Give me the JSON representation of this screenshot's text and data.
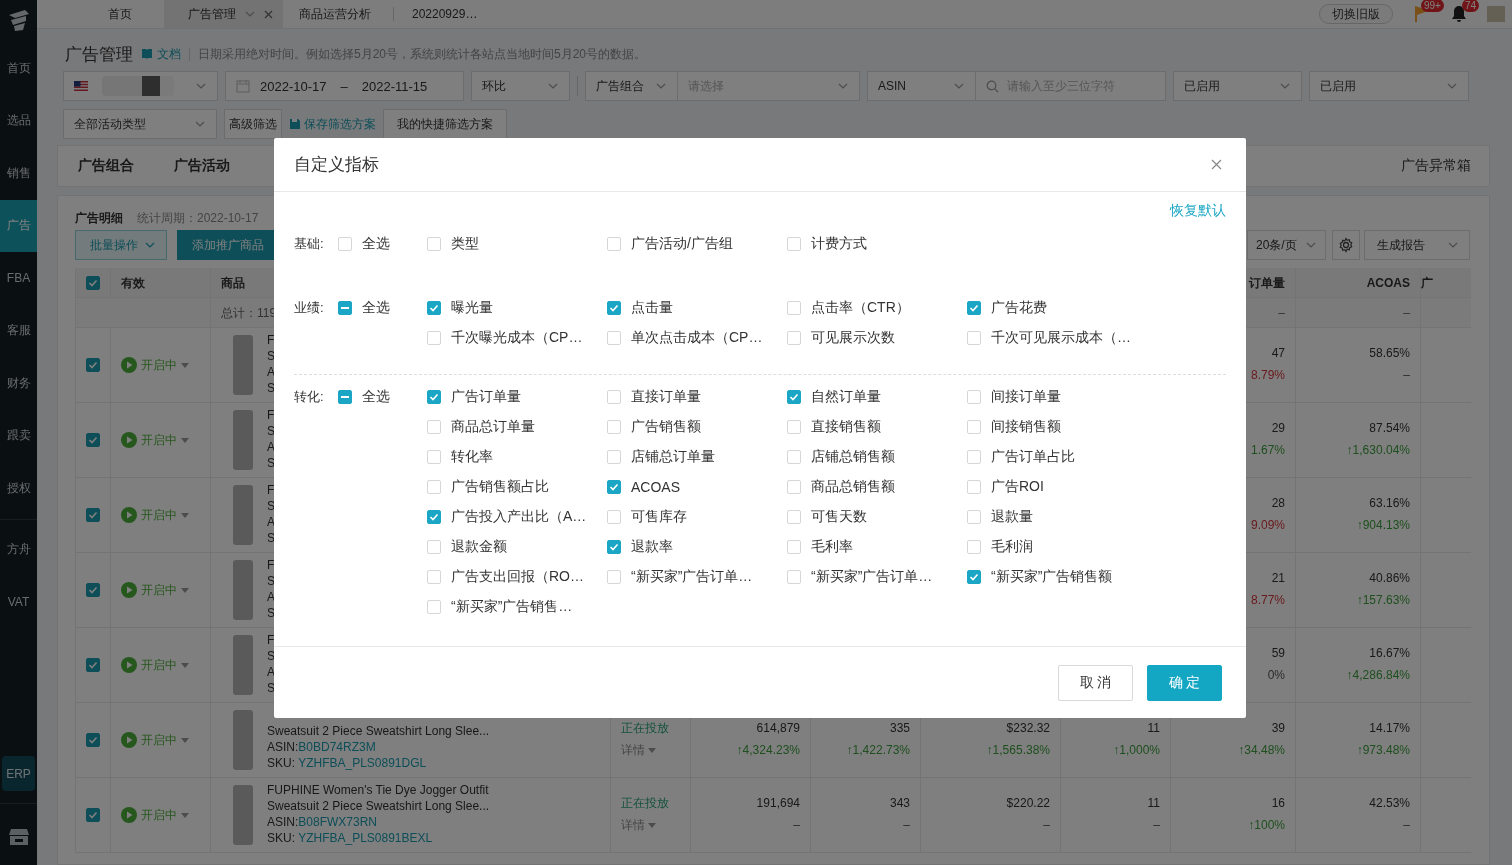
{
  "sidebar": {
    "sections": [
      {
        "items": [
          {
            "label": "首页",
            "selected": false
          },
          {
            "label": "选品",
            "selected": false
          },
          {
            "label": "销售",
            "selected": false
          },
          {
            "label": "广告",
            "selected": true
          },
          {
            "label": "FBA",
            "selected": false
          },
          {
            "label": "客服",
            "selected": false
          },
          {
            "label": "财务",
            "selected": false
          },
          {
            "label": "跟卖",
            "selected": false
          },
          {
            "label": "授权",
            "selected": false
          }
        ]
      },
      {
        "items": [
          {
            "label": "方舟",
            "selected": false
          },
          {
            "label": "VAT",
            "selected": false
          }
        ]
      }
    ],
    "erp": "ERP"
  },
  "tabs": [
    {
      "label": "首页",
      "selected": false,
      "closable": false
    },
    {
      "label": "广告管理",
      "selected": true,
      "closable": true
    },
    {
      "label": "商品运营分析",
      "selected": false,
      "closable": false
    },
    {
      "label": "20220929…",
      "selected": false,
      "closable": false
    }
  ],
  "header_right": {
    "switch_button": "切换旧版",
    "flag_badge": "99+",
    "bell_badge": "74"
  },
  "page": {
    "title": "广告管理",
    "doc_link": "文档",
    "note": "日期采用绝对时间。例如选择5月20号，系统则统计各站点当地时间5月20号的数据。"
  },
  "filters": {
    "date_start": "2022-10-17",
    "date_sep": "–",
    "date_end": "2022-11-15",
    "compare": "环比",
    "group_type": "广告组合",
    "group_placeholder": "请选择",
    "search_type": "ASIN",
    "search_placeholder": "请输入至少三位字符",
    "status_1": "已启用",
    "status_2": "已启用",
    "campaign_type": "全部活动类型",
    "advanced": "高级筛选",
    "save_scheme": "保存筛选方案",
    "my_schemes": "我的快捷筛选方案"
  },
  "view_tabs": {
    "left": [
      "广告组合",
      "广告活动"
    ],
    "right": "广告异常箱"
  },
  "table_card": {
    "title": "广告明细",
    "period": "统计周期：2022-10-17",
    "batch_button": "批量操作",
    "add_button": "添加推广商品",
    "page_size": "20条/页",
    "report_button": "生成报告"
  },
  "table": {
    "header": {
      "checked": true,
      "status": "有效",
      "product": "商品",
      "column_9": "订单量",
      "column_10": "ACOAS",
      "column_11": "广"
    },
    "summary": {
      "product": "总计：119",
      "column_9": "–",
      "column_10": "–"
    },
    "rows": [
      {
        "checked": true,
        "status": "开启中",
        "product": [
          {
            "text": "F"
          },
          {
            "text": "S"
          },
          {
            "text": "A"
          },
          {
            "text": "S"
          }
        ],
        "column_9": {
          "value": "47",
          "change": "8.79%",
          "rising": false,
          "falling": true
        },
        "column_10": {
          "value": "58.65%",
          "change": "–",
          "rising": false,
          "falling": false
        }
      },
      {
        "checked": true,
        "status": "开启中",
        "product": [
          {
            "text": "F"
          },
          {
            "text": "S"
          },
          {
            "text": "A"
          },
          {
            "text": "S"
          }
        ],
        "column_9": {
          "value": "29",
          "change": "1.67%",
          "rising": true,
          "falling": false
        },
        "column_10": {
          "value": "87.54%",
          "change": "↑1,630.04%",
          "rising": true,
          "falling": false
        }
      },
      {
        "checked": true,
        "status": "开启中",
        "product": [
          {
            "text": "F"
          },
          {
            "text": "S"
          },
          {
            "text": "A"
          },
          {
            "text": "S"
          }
        ],
        "column_9": {
          "value": "28",
          "change": "9.09%",
          "rising": false,
          "falling": true
        },
        "column_10": {
          "value": "63.16%",
          "change": "↑904.13%",
          "rising": true,
          "falling": false
        }
      },
      {
        "checked": true,
        "status": "开启中",
        "product": [
          {
            "text": "F"
          },
          {
            "text": "S"
          },
          {
            "text": "A"
          },
          {
            "text": "S"
          }
        ],
        "column_9": {
          "value": "21",
          "change": "8.77%",
          "rising": false,
          "falling": true
        },
        "column_10": {
          "value": "40.86%",
          "change": "↑157.63%",
          "rising": true,
          "falling": false
        }
      },
      {
        "checked": true,
        "status": "开启中",
        "product": [
          {
            "text": "F"
          },
          {
            "text": "S"
          },
          {
            "text": "A"
          },
          {
            "text": "S"
          }
        ],
        "column_9": {
          "value": "59",
          "change": "0%",
          "rising": false,
          "falling": false
        },
        "column_10": {
          "value": "16.67%",
          "change": "↑4,286.84%",
          "rising": true,
          "falling": false
        }
      },
      {
        "checked": true,
        "status": "开启中",
        "product": [
          {
            "text": "Sweatsuit 2 Piece Sweatshirt Long Slee..."
          },
          {
            "text": "ASIN:",
            "link": "B0BD74RZ3M"
          },
          {
            "text": "SKU: ",
            "link": "YZHFBA_PLS0891DGL"
          }
        ],
        "column_4": {
          "status": "正在投放",
          "details": "详情"
        },
        "column_5": {
          "value": "614,879",
          "change": "↑4,324.23%",
          "rising": true,
          "falling": false
        },
        "column_6": {
          "value": "335",
          "change": "↑1,422.73%",
          "rising": true,
          "falling": false
        },
        "column_7": {
          "value": "$232.32",
          "change": "↑1,565.38%",
          "rising": true,
          "falling": false
        },
        "column_8": {
          "value": "11",
          "change": "↑1,000%",
          "rising": true,
          "falling": false
        },
        "column_9": {
          "value": "39",
          "change": "↑34.48%",
          "rising": true,
          "falling": false
        },
        "column_10": {
          "value": "14.17%",
          "change": "↑973.48%",
          "rising": true,
          "falling": false
        }
      },
      {
        "checked": true,
        "status": "开启中",
        "product": [
          {
            "text": "FUPHINE Women's Tie Dye Jogger Outfit"
          },
          {
            "text": "Sweatsuit 2 Piece Sweatshirt Long Slee..."
          },
          {
            "text": "ASIN:",
            "link": "B08FWX73RN"
          },
          {
            "text": "SKU: ",
            "link": "YZHFBA_PLS0891BEXL"
          }
        ],
        "column_4": {
          "status": "正在投放",
          "details": "详情"
        },
        "column_5": {
          "value": "191,694",
          "change": "–",
          "rising": false,
          "falling": false
        },
        "column_6": {
          "value": "343",
          "change": "–",
          "rising": false,
          "falling": false
        },
        "column_7": {
          "value": "$220.22",
          "change": "–",
          "rising": false,
          "falling": false
        },
        "column_8": {
          "value": "11",
          "change": "–",
          "rising": false,
          "falling": false
        },
        "column_9": {
          "value": "16",
          "change": "↑100%",
          "rising": true,
          "falling": false
        },
        "column_10": {
          "value": "42.53%",
          "change": "–",
          "rising": false,
          "falling": false
        }
      }
    ]
  },
  "dialog": {
    "title": "自定义指标",
    "reset": "恢复默认",
    "sections": [
      {
        "label": "基础:",
        "divider_after": false,
        "select_all": {
          "label": "全选",
          "indeterminate": false
        },
        "items": [
          {
            "label": "类型",
            "checked": false
          },
          {
            "label": "广告活动/广告组",
            "checked": false
          },
          {
            "label": "计费方式",
            "checked": false
          }
        ]
      },
      {
        "label": "业绩:",
        "divider_after": true,
        "select_all": {
          "label": "全选",
          "indeterminate": true
        },
        "items": [
          {
            "label": "曝光量",
            "checked": true
          },
          {
            "label": "点击量",
            "checked": true
          },
          {
            "label": "点击率（CTR）",
            "checked": false
          },
          {
            "label": "广告花费",
            "checked": true
          },
          {
            "label": "千次曝光成本（CP…",
            "checked": false
          },
          {
            "label": "单次点击成本（CP…",
            "checked": false
          },
          {
            "label": "可见展示次数",
            "checked": false
          },
          {
            "label": "千次可见展示成本（…",
            "checked": false
          }
        ]
      },
      {
        "label": "转化:",
        "divider_after": false,
        "select_all": {
          "label": "全选",
          "indeterminate": true
        },
        "items": [
          {
            "label": "广告订单量",
            "checked": true
          },
          {
            "label": "直接订单量",
            "checked": false
          },
          {
            "label": "自然订单量",
            "checked": true
          },
          {
            "label": "间接订单量",
            "checked": false
          },
          {
            "label": "商品总订单量",
            "checked": false
          },
          {
            "label": "广告销售额",
            "checked": false
          },
          {
            "label": "直接销售额",
            "checked": false
          },
          {
            "label": "间接销售额",
            "checked": false
          },
          {
            "label": "转化率",
            "checked": false
          },
          {
            "label": "店铺总订单量",
            "checked": false
          },
          {
            "label": "店铺总销售额",
            "checked": false
          },
          {
            "label": "广告订单占比",
            "checked": false
          },
          {
            "label": "广告销售额占比",
            "checked": false
          },
          {
            "label": "ACOAS",
            "checked": true
          },
          {
            "label": "商品总销售额",
            "checked": false
          },
          {
            "label": "广告ROI",
            "checked": false
          },
          {
            "label": "广告投入产出比（A…",
            "checked": true
          },
          {
            "label": "可售库存",
            "checked": false
          },
          {
            "label": "可售天数",
            "checked": false
          },
          {
            "label": "退款量",
            "checked": false
          },
          {
            "label": "退款金额",
            "checked": false
          },
          {
            "label": "退款率",
            "checked": true
          },
          {
            "label": "毛利率",
            "checked": false
          },
          {
            "label": "毛利润",
            "checked": false
          },
          {
            "label": "广告支出回报（RO…",
            "checked": false
          },
          {
            "label": "“新买家”广告订单…",
            "checked": false
          },
          {
            "label": "“新买家”广告订单…",
            "checked": false
          },
          {
            "label": "“新买家”广告销售额",
            "checked": true
          },
          {
            "label": "“新买家”广告销售…",
            "checked": false
          }
        ]
      }
    ],
    "cancel": "取 消",
    "confirm": "确 定"
  }
}
